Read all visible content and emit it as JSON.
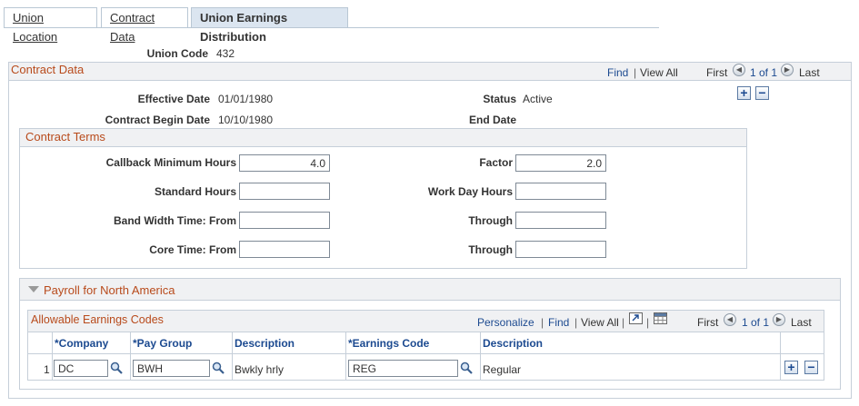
{
  "tabs": [
    {
      "label": "Union Location"
    },
    {
      "label": "Contract Data"
    },
    {
      "label": "Union Earnings Distribution"
    }
  ],
  "union": {
    "code_label": "Union Code",
    "code_value": "432"
  },
  "contract": {
    "title": "Contract Data",
    "nav": {
      "find": "Find",
      "view_all": "View All",
      "first": "First",
      "count": "1 of 1",
      "last": "Last"
    },
    "effective_date_label": "Effective Date",
    "effective_date": "01/01/1980",
    "status_label": "Status",
    "status": "Active",
    "begin_date_label": "Contract Begin Date",
    "begin_date": "10/10/1980",
    "end_date_label": "End Date",
    "end_date": ""
  },
  "terms": {
    "title": "Contract Terms",
    "callback_label": "Callback Minimum Hours",
    "callback_value": "4.0",
    "factor_label": "Factor",
    "factor_value": "2.0",
    "standard_label": "Standard Hours",
    "standard_value": "",
    "workday_label": "Work Day Hours",
    "workday_value": "",
    "band_label": "Band Width Time: From",
    "band_value": "",
    "band_through_label": "Through",
    "band_through_value": "",
    "core_label": "Core Time: From",
    "core_value": "",
    "core_through_label": "Through",
    "core_through_value": ""
  },
  "payroll": {
    "title": "Payroll for North America",
    "grid": {
      "title": "Allowable Earnings Codes",
      "nav": {
        "personalize": "Personalize",
        "find": "Find",
        "view_all": "View All",
        "first": "First",
        "count": "1 of 1",
        "last": "Last"
      },
      "columns": [
        "*Company",
        "*Pay Group",
        "Description",
        "*Earnings Code",
        "Description"
      ],
      "rows": [
        {
          "num": "1",
          "company": "DC",
          "pay_group": "BWH",
          "pay_group_desc": "Bwkly hrly",
          "earnings_code": "REG",
          "earnings_desc": "Regular"
        }
      ]
    }
  },
  "colors": {
    "accent": "#1c4a90",
    "title": "#b84a1b",
    "border": "#c6cfd9"
  }
}
